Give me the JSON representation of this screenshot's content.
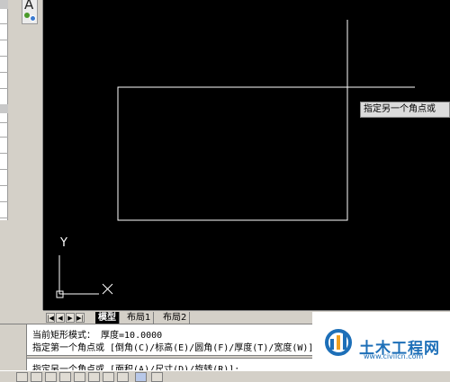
{
  "palette": {
    "tool_glyph": "A"
  },
  "canvas": {
    "tooltip": "指定另一个角点或",
    "ucs_y_label": "Y",
    "ucs_x_label": "X",
    "background": "#000000",
    "line_color": "#ffffff"
  },
  "tabs": {
    "nav": [
      "|◀",
      "◀",
      "▶",
      "▶|"
    ],
    "items": [
      {
        "label": "模型",
        "active": true
      },
      {
        "label": "布局1",
        "active": false
      },
      {
        "label": "布局2",
        "active": false
      }
    ]
  },
  "command": {
    "line1": "当前矩形模式：  厚度=10.0000",
    "line2": "指定第一个角点或 [倒角(C)/标高(E)/圆角(F)/厚度(T)/宽度(W)]:",
    "line3": "指定另一个角点或 [面积(A)/尺寸(D)/旋转(R)]:"
  },
  "watermark": {
    "title": "土木工程网",
    "url": "www.civilcn.com",
    "brand_color": "#1d6fb8"
  }
}
